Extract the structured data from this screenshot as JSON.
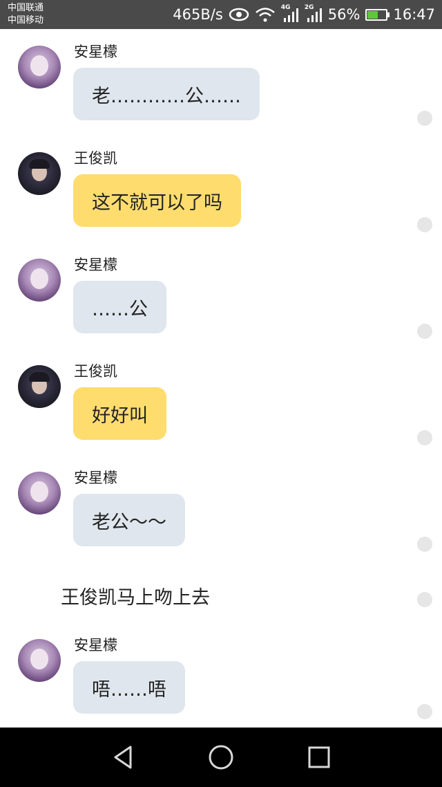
{
  "status_bar": {
    "carrier_1": "中国联通",
    "carrier_2": "中国移动",
    "net_speed": "465B/s",
    "signal_1_type": "4G",
    "signal_2_type": "2G",
    "battery_percent": "56%",
    "battery_level": 0.56,
    "time": "16:47",
    "icons": [
      "eye-icon",
      "wifi-icon",
      "signal-icon",
      "battery-icon"
    ]
  },
  "messages": [
    {
      "sender": "安星檬",
      "text": "老…………公……",
      "style": "gray"
    },
    {
      "sender": "王俊凯",
      "text": "这不就可以了吗",
      "style": "yellow"
    },
    {
      "sender": "安星檬",
      "text": "……公",
      "style": "gray"
    },
    {
      "sender": "王俊凯",
      "text": "好好叫",
      "style": "yellow"
    },
    {
      "sender": "安星檬",
      "text": "老公～～",
      "style": "gray"
    },
    {
      "narration": "王俊凯马上吻上去"
    },
    {
      "sender": "安星檬",
      "text": "唔……唔",
      "style": "gray"
    }
  ],
  "colors": {
    "status_bar_bg": "#4a4a4a",
    "bubble_gray": "#dfe6ed",
    "bubble_yellow": "#fedc6e",
    "nav_bar_bg": "#000000"
  },
  "nav_bar": {
    "icons": [
      "back-icon",
      "home-icon",
      "recents-icon"
    ]
  }
}
